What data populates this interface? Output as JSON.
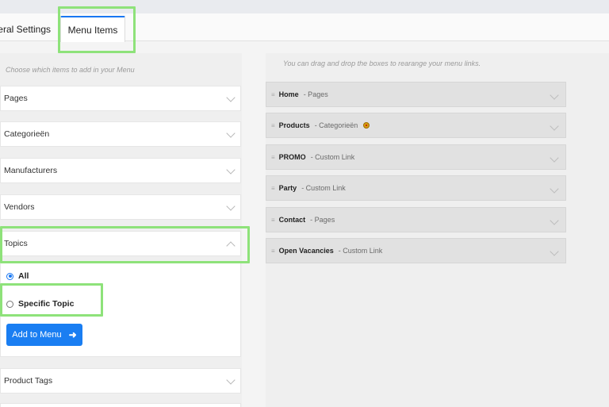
{
  "tabs": [
    {
      "label": "General Settings",
      "active": false
    },
    {
      "label": "Menu Items",
      "active": true
    }
  ],
  "left": {
    "hint": "Choose which items to add in your Menu",
    "sections": [
      "Pages",
      "Categorieën",
      "Manufacturers",
      "Vendors",
      "Topics",
      "Product Tags"
    ],
    "topics": {
      "options": [
        {
          "label": "All",
          "checked": true
        },
        {
          "label": "Specific Topic",
          "checked": false
        }
      ],
      "add_button": "Add to Menu",
      "add_icon": "arrow-right-icon"
    }
  },
  "right": {
    "hint": "You can drag and drop the boxes to rearange your menu links.",
    "items": [
      {
        "title": "Home",
        "type": "- Pages"
      },
      {
        "title": "Products",
        "type": "- Categorieën",
        "warning": true
      },
      {
        "title": "PROMO",
        "type": "- Custom Link"
      },
      {
        "title": "Party",
        "type": "- Custom Link"
      },
      {
        "title": "Contact",
        "type": "- Pages"
      },
      {
        "title": "Open Vacancies",
        "type": "- Custom Link"
      }
    ]
  },
  "colors": {
    "accent": "#1a7ef2",
    "highlight": "#8ee27a"
  }
}
